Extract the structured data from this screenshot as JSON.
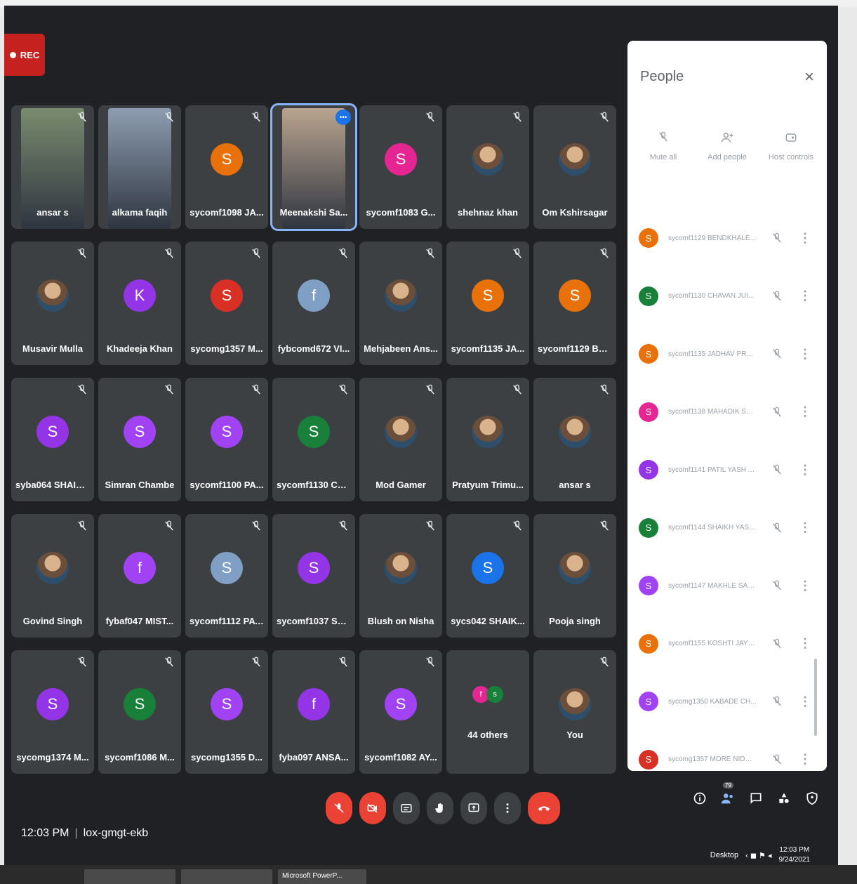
{
  "recording": {
    "label": "REC"
  },
  "tiles": [
    {
      "name": "ansar s",
      "kind": "camera",
      "color": "#7a8b6f"
    },
    {
      "name": "alkama faqih",
      "kind": "camera",
      "color": "#8d9db0"
    },
    {
      "name": "sycomf1098 JA...",
      "kind": "avatar",
      "letter": "S",
      "color": "#e8710a"
    },
    {
      "name": "Meenakshi Sa...",
      "kind": "camera",
      "color": "#b9a48f",
      "active": true
    },
    {
      "name": "sycomf1083 G...",
      "kind": "avatar",
      "letter": "S",
      "color": "#e52592"
    },
    {
      "name": "shehnaz khan",
      "kind": "photo"
    },
    {
      "name": "Om Kshirsagar",
      "kind": "photo"
    },
    {
      "name": "Musavir Mulla",
      "kind": "photo"
    },
    {
      "name": "Khadeeja Khan",
      "kind": "avatar",
      "letter": "K",
      "color": "#9334e6"
    },
    {
      "name": "sycomg1357 M...",
      "kind": "avatar",
      "letter": "S",
      "color": "#d93025"
    },
    {
      "name": "fybcomd672 VI...",
      "kind": "avatar",
      "letter": "f",
      "color": "#7fa0c4"
    },
    {
      "name": "Mehjabeen Ans...",
      "kind": "photo"
    },
    {
      "name": "sycomf1135 JA...",
      "kind": "avatar",
      "letter": "S",
      "color": "#e8710a"
    },
    {
      "name": "sycomf1129 BE...",
      "kind": "avatar",
      "letter": "S",
      "color": "#e8710a"
    },
    {
      "name": "syba064 SHAIK...",
      "kind": "avatar",
      "letter": "S",
      "color": "#9334e6"
    },
    {
      "name": "Simran Chambe",
      "kind": "avatar",
      "letter": "S",
      "color": "#a142f4"
    },
    {
      "name": "sycomf1100 PA...",
      "kind": "avatar",
      "letter": "S",
      "color": "#a142f4"
    },
    {
      "name": "sycomf1130 CH...",
      "kind": "avatar",
      "letter": "S",
      "color": "#188038"
    },
    {
      "name": "Mod Gamer",
      "kind": "photo"
    },
    {
      "name": "Pratyum Trimu...",
      "kind": "photo"
    },
    {
      "name": "ansar s",
      "kind": "photo"
    },
    {
      "name": "Govind Singh",
      "kind": "photo"
    },
    {
      "name": "fybaf047 MIST...",
      "kind": "avatar",
      "letter": "f",
      "color": "#a142f4"
    },
    {
      "name": "sycomf1112 PAT...",
      "kind": "avatar",
      "letter": "S",
      "color": "#7fa0c4"
    },
    {
      "name": "sycomf1037 SH...",
      "kind": "avatar",
      "letter": "S",
      "color": "#9334e6"
    },
    {
      "name": "Blush on Nisha",
      "kind": "photo"
    },
    {
      "name": "sycs042 SHAIK...",
      "kind": "avatar",
      "letter": "S",
      "color": "#1a73e8"
    },
    {
      "name": "Pooja singh",
      "kind": "photo"
    },
    {
      "name": "sycomg1374 M...",
      "kind": "avatar",
      "letter": "S",
      "color": "#9334e6"
    },
    {
      "name": "sycomf1086 M...",
      "kind": "avatar",
      "letter": "S",
      "color": "#188038"
    },
    {
      "name": "sycomg1355 D...",
      "kind": "avatar",
      "letter": "S",
      "color": "#a142f4"
    },
    {
      "name": "fyba097 ANSA...",
      "kind": "avatar",
      "letter": "f",
      "color": "#9334e6"
    },
    {
      "name": "sycomf1082 AY...",
      "kind": "avatar",
      "letter": "S",
      "color": "#a142f4"
    },
    {
      "name": "44 others",
      "kind": "others"
    },
    {
      "name": "You",
      "kind": "photo"
    }
  ],
  "people_panel": {
    "title": "People",
    "close": "×",
    "actions": [
      {
        "label": "Mute all",
        "icon": "mic-off-icon"
      },
      {
        "label": "Add people",
        "icon": "add-person-icon"
      },
      {
        "label": "Host controls",
        "icon": "host-controls-icon"
      }
    ],
    "participants": [
      {
        "name": "sycomf1129 BENDKHALE...",
        "letter": "S",
        "color": "#e8710a"
      },
      {
        "name": "sycomf1130 CHAVAN JUI...",
        "letter": "S",
        "color": "#188038"
      },
      {
        "name": "sycomf1135 JADHAV PRA...",
        "letter": "S",
        "color": "#e8710a"
      },
      {
        "name": "sycomf1138 MAHADIK SH...",
        "letter": "S",
        "color": "#e52592"
      },
      {
        "name": "sycomf1141 PATIL YASH A...",
        "letter": "S",
        "color": "#9334e6"
      },
      {
        "name": "sycomf1144 SHAIKH YASE...",
        "letter": "S",
        "color": "#188038"
      },
      {
        "name": "sycomf1147 MAKHLE SAH...",
        "letter": "S",
        "color": "#a142f4"
      },
      {
        "name": "sycomf1155 KOSHTI JAYE...",
        "letter": "S",
        "color": "#e8710a"
      },
      {
        "name": "sycomg1350 KABADE CH...",
        "letter": "S",
        "color": "#a142f4"
      },
      {
        "name": "sycomg1357 MORE NIDHI...",
        "letter": "S",
        "color": "#d93025"
      }
    ]
  },
  "bottom": {
    "time": "12:03 PM",
    "meeting_code": "lox-gmgt-ekb",
    "participant_count": "79"
  },
  "system": {
    "desktop": "Desktop",
    "clock_time": "12:03 PM",
    "clock_date": "9/24/2021",
    "taskbar_item": "Microsoft PowerP..."
  }
}
